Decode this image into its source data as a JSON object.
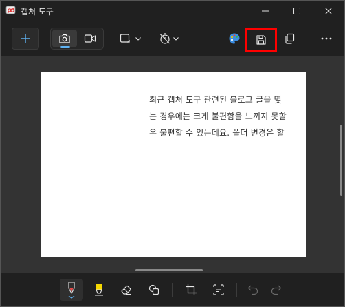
{
  "window": {
    "title": "캡처 도구"
  },
  "toolbar": {
    "new_icon": "plus-icon",
    "modes": [
      "camera-icon",
      "video-icon"
    ],
    "shape_icon": "rectangle-snip-icon",
    "delay_icon": "timer-off-icon",
    "paint_icon": "paint-icon",
    "save_icon": "save-icon",
    "copy_icon": "copy-icon",
    "more_icon": "more-icon"
  },
  "document": {
    "lines": [
      "최근 캡처 도구 관련된 블로그 글을 몇",
      "는 경우에는 크게 불편함을 느끼지 못할",
      "우 불편할 수 있는데요. 폴더 변경은 할"
    ]
  },
  "bottom_tools": [
    "ballpoint-pen-icon",
    "highlighter-icon",
    "eraser-icon",
    "shapes-icon",
    "crop-icon",
    "text-actions-icon",
    "undo-icon",
    "redo-icon"
  ],
  "colors": {
    "highlight": "#ff0000",
    "accent": "#5fb2f2",
    "pen": "#e74c4c",
    "highlighter": "#f5d800"
  }
}
